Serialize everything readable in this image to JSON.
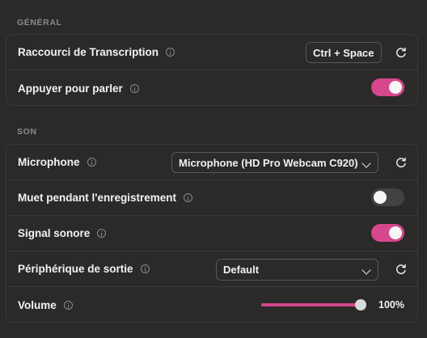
{
  "general": {
    "title": "GÉNÉRAL",
    "shortcut_label": "Raccourci de Transcription",
    "shortcut_value": "Ctrl + Space",
    "push_to_talk_label": "Appuyer pour parler",
    "push_to_talk_enabled": true
  },
  "son": {
    "title": "SON",
    "microphone_label": "Microphone",
    "microphone_value": "Microphone (HD Pro Webcam C920)",
    "mute_label": "Muet pendant l'enregistrement",
    "mute_enabled": false,
    "beep_label": "Signal sonore",
    "beep_enabled": true,
    "output_label": "Périphérique de sortie",
    "output_value": "Default",
    "volume_label": "Volume",
    "volume_value": "100%",
    "volume_level": 1.0
  },
  "colors": {
    "accent": "#d6478c",
    "background": "#2b2a29",
    "border": "#3d3b39"
  }
}
